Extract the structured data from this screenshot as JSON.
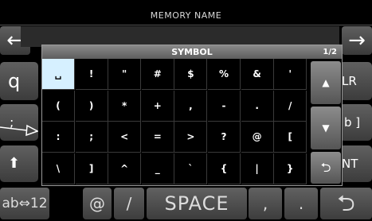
{
  "header": {
    "title": "MEMORY NAME"
  },
  "nav": {
    "left_arrow": "←",
    "right_arrow": "→"
  },
  "background_keys": {
    "q": "q",
    "semicolon": ";",
    "shift": "⬆",
    "lr": "LR",
    "b_bracket": "b ]",
    "nt": "NT"
  },
  "bottom_bar": {
    "mode_label": "ab⇔12",
    "at": "@",
    "slash": "/",
    "space": "SPACE",
    "comma": ",",
    "dot": ".",
    "enter": "⮌"
  },
  "dialog": {
    "title": "SYMBOL",
    "page": "1/2",
    "symbols": [
      "␣",
      "!",
      "\"",
      "#",
      "$",
      "%",
      "&",
      "'",
      "(",
      ")",
      "*",
      "+",
      ",",
      "-",
      ".",
      "/",
      ":",
      ";",
      "<",
      "=",
      ">",
      "?",
      "@",
      "[",
      "\\",
      "]",
      "^",
      "_",
      "`",
      "{",
      "|",
      "}"
    ],
    "selected_index": 0,
    "up_icon": "▲",
    "down_icon": "▼",
    "back_icon": "⮌"
  }
}
